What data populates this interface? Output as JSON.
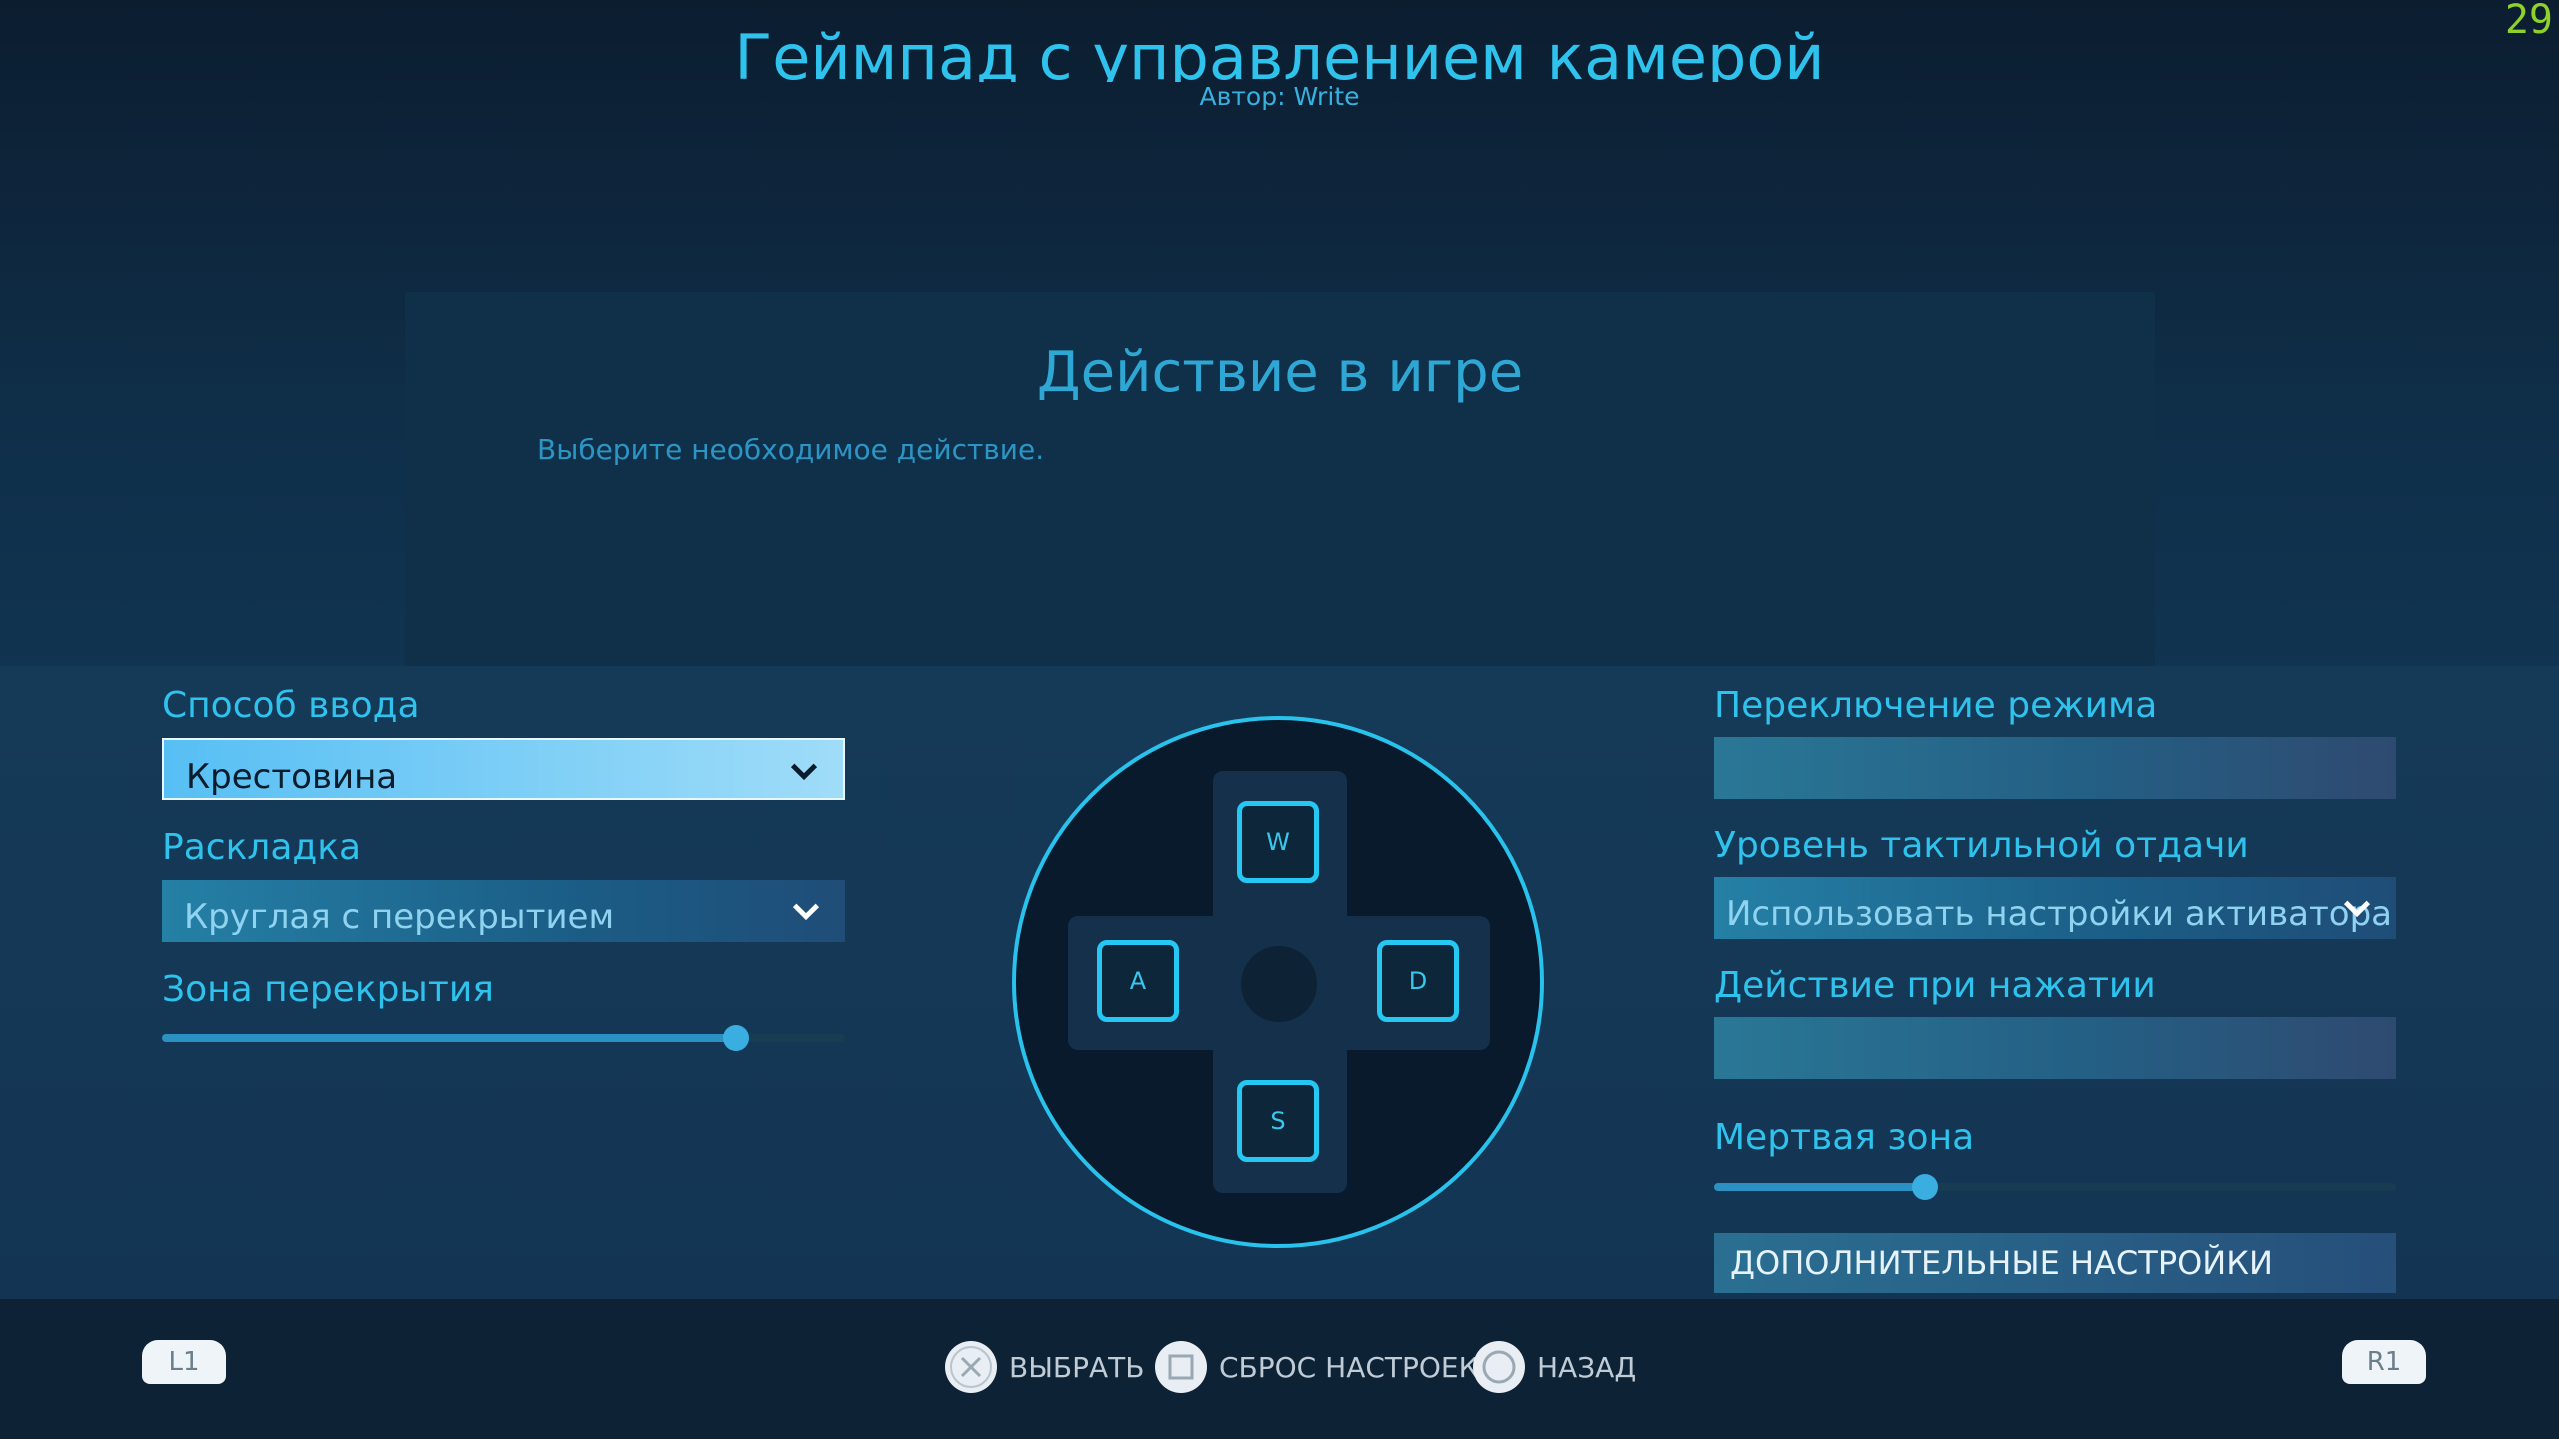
{
  "header": {
    "fps": "29",
    "title": "Геймпад с управлением камерой",
    "author": "Автор: Write"
  },
  "action_panel": {
    "title": "Действие в игре",
    "description": "Выберите необходимое действие."
  },
  "left_settings": {
    "input_method": {
      "label": "Способ ввода",
      "value": "Крестовина"
    },
    "layout": {
      "label": "Раскладка",
      "value": "Круглая с перекрытием"
    },
    "overlap_zone": {
      "label": "Зона перекрытия",
      "value_fraction": 0.84
    }
  },
  "dpad": {
    "up": "W",
    "left": "A",
    "right": "D",
    "down": "S"
  },
  "right_settings": {
    "mode_switch": {
      "label": "Переключение режима"
    },
    "haptic": {
      "label": "Уровень тактильной отдачи",
      "value": "Использовать настройки активатора"
    },
    "click_action": {
      "label": "Действие при нажатии"
    },
    "dead_zone": {
      "label": "Мертвая зона",
      "value_fraction": 0.31
    },
    "advanced_button": "ДОПОЛНИТЕЛЬНЫЕ НАСТРОЙКИ"
  },
  "footer": {
    "l1": "L1",
    "r1": "R1",
    "select": "ВЫБРАТЬ",
    "reset": "СБРОС НАСТРОЕК",
    "back": "НАЗАД"
  },
  "colors": {
    "accent": "#2ec2ec",
    "fps": "#8fd12b",
    "active_dropdown": "#57bff4"
  },
  "icons": {
    "chevron": "chevron-down-icon",
    "select": "cross-button-icon",
    "reset": "square-button-icon",
    "back": "circle-button-icon"
  }
}
